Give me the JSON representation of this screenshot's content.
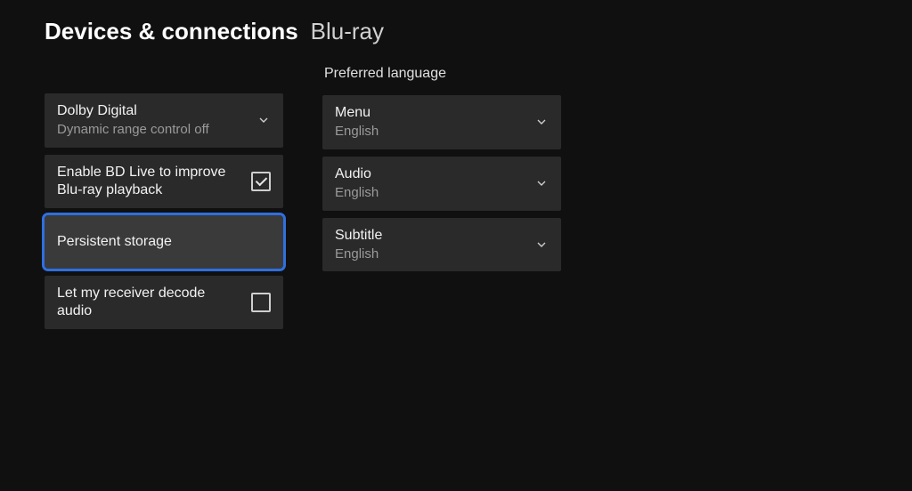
{
  "header": {
    "breadcrumb": "Devices & connections",
    "title": "Blu-ray"
  },
  "left": {
    "dolby": {
      "label": "Dolby Digital",
      "sub": "Dynamic range control off"
    },
    "bdlive": {
      "label": "Enable BD Live to improve Blu-ray playback",
      "checked": true
    },
    "persistent": {
      "label": "Persistent storage"
    },
    "receiver": {
      "label": "Let my receiver decode audio",
      "checked": false
    }
  },
  "right": {
    "section": "Preferred language",
    "menu": {
      "label": "Menu",
      "value": "English"
    },
    "audio": {
      "label": "Audio",
      "value": "English"
    },
    "subtitle": {
      "label": "Subtitle",
      "value": "English"
    }
  }
}
